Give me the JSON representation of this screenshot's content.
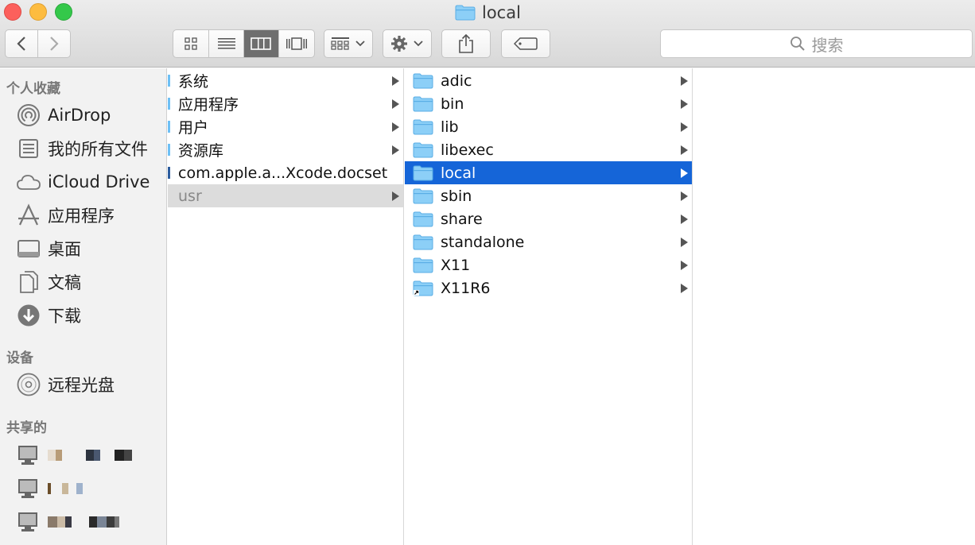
{
  "window": {
    "title": "local",
    "title_icon": "folder-icon"
  },
  "toolbar": {
    "back_icon": "chevron-left-icon",
    "forward_icon": "chevron-right-icon",
    "view_modes": [
      "icon-view-icon",
      "list-view-icon",
      "column-view-icon",
      "cover-flow-icon"
    ],
    "active_view": "column",
    "arrange_icon": "arrange-grid-icon",
    "action_icon": "gear-icon",
    "share_icon": "share-icon",
    "tag_icon": "tag-icon",
    "search": {
      "placeholder": "搜索",
      "icon": "search-icon"
    }
  },
  "sidebar": {
    "favorites_header": "个人收藏",
    "favorites": [
      {
        "label": "AirDrop",
        "icon": "airdrop-icon"
      },
      {
        "label": "我的所有文件",
        "icon": "all-files-icon"
      },
      {
        "label": "iCloud Drive",
        "icon": "cloud-icon"
      },
      {
        "label": "应用程序",
        "icon": "applications-icon"
      },
      {
        "label": "桌面",
        "icon": "desktop-icon"
      },
      {
        "label": "文稿",
        "icon": "documents-icon"
      },
      {
        "label": "下载",
        "icon": "download-icon"
      }
    ],
    "devices_header": "设备",
    "devices": [
      {
        "label": "远程光盘",
        "icon": "disc-icon"
      }
    ],
    "shared_header": "共享的",
    "shared": [
      {
        "label": "",
        "icon": "computer-icon"
      },
      {
        "label": "",
        "icon": "computer-icon"
      },
      {
        "label": "",
        "icon": "computer-icon"
      }
    ]
  },
  "columns": {
    "col1": [
      {
        "name": "系统",
        "has_children": true
      },
      {
        "name": "应用程序",
        "has_children": true
      },
      {
        "name": "用户",
        "has_children": true
      },
      {
        "name": "资源库",
        "has_children": true
      },
      {
        "name": "com.apple.a...Xcode.docset",
        "has_children": false
      },
      {
        "name": "usr",
        "has_children": true,
        "state": "parent-selected"
      }
    ],
    "col2": [
      {
        "name": "adic",
        "has_children": true
      },
      {
        "name": "bin",
        "has_children": true
      },
      {
        "name": "lib",
        "has_children": true
      },
      {
        "name": "libexec",
        "has_children": true
      },
      {
        "name": "local",
        "has_children": true,
        "state": "selected"
      },
      {
        "name": "sbin",
        "has_children": true
      },
      {
        "name": "share",
        "has_children": true
      },
      {
        "name": "standalone",
        "has_children": true
      },
      {
        "name": "X11",
        "has_children": true
      },
      {
        "name": "X11R6",
        "has_children": true,
        "alias": true
      }
    ],
    "col3": []
  },
  "colors": {
    "selection": "#1565d8",
    "folder": "#6ec0f5",
    "sidebar_bg": "#f2f2f2",
    "toolbar_bg": "#dcdcdc"
  }
}
